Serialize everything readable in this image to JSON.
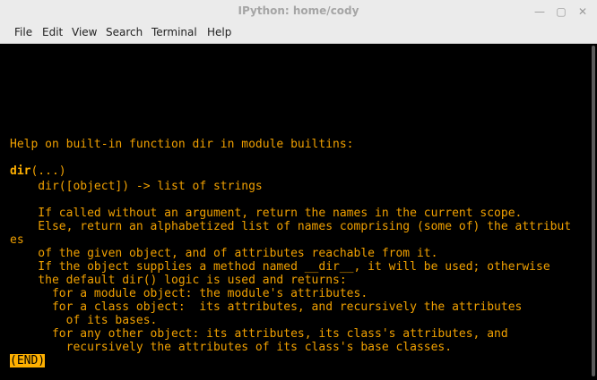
{
  "window": {
    "title": "IPython: home/cody",
    "minimize_symbol": "—",
    "maximize_symbol": "▢",
    "close_symbol": "✕"
  },
  "menu": {
    "items": [
      "File",
      "Edit",
      "View",
      "Search",
      "Terminal",
      "Help"
    ]
  },
  "terminal": {
    "lines": [
      "Help on built-in function dir in module builtins:",
      "",
      "dir(...)",
      "    dir([object]) -> list of strings",
      "",
      "    If called without an argument, return the names in the current scope.",
      "    Else, return an alphabetized list of names comprising (some of) the attribut",
      "es",
      "    of the given object, and of attributes reachable from it.",
      "    If the object supplies a method named __dir__, it will be used; otherwise",
      "    the default dir() logic is used and returns:",
      "      for a module object: the module's attributes.",
      "      for a class object:  its attributes, and recursively the attributes",
      "        of its bases.",
      "      for any other object: its attributes, its class's attributes, and",
      "        recursively the attributes of its class's base classes.",
      "(END)"
    ],
    "dir_bold": "dir",
    "dir_rest": "(...)"
  },
  "colors": {
    "terminal_bg": "#000000",
    "terminal_fg": "#f0a000",
    "titlebar_bg": "#ebebeb"
  }
}
